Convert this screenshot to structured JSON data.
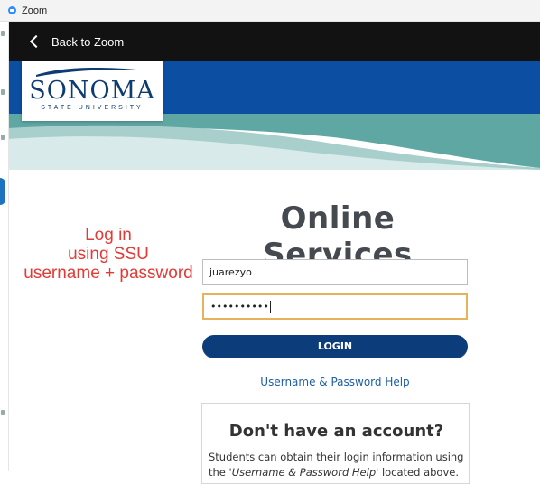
{
  "window": {
    "title": "Zoom",
    "app_icon": "zoom-icon"
  },
  "nav": {
    "back_label": "Back to Zoom",
    "back_icon": "chevron-left-icon"
  },
  "logo": {
    "name": "SONOMA",
    "subtitle": "STATE UNIVERSITY"
  },
  "annotation": {
    "lines": [
      "Log in",
      "using SSU",
      "username + password"
    ],
    "color": "#e53935"
  },
  "main": {
    "heading": "Online Services",
    "username_value": "juarezyo",
    "password_mask": "••••••••••",
    "login_label": "LOGIN",
    "help_link": "Username & Password Help"
  },
  "account": {
    "title": "Don't have an account?",
    "text_line1": "Students can obtain their login information using",
    "text_line2_prefix": "the '",
    "text_line2_italic": "Username & Password Help",
    "text_line2_suffix": "' located above."
  },
  "colors": {
    "banner_blue": "#0b4ea2",
    "banner_teal": "#5fa7a3",
    "navy": "#0c3d7a",
    "link": "#1d5fa6",
    "focus_border": "#e6b35a"
  }
}
